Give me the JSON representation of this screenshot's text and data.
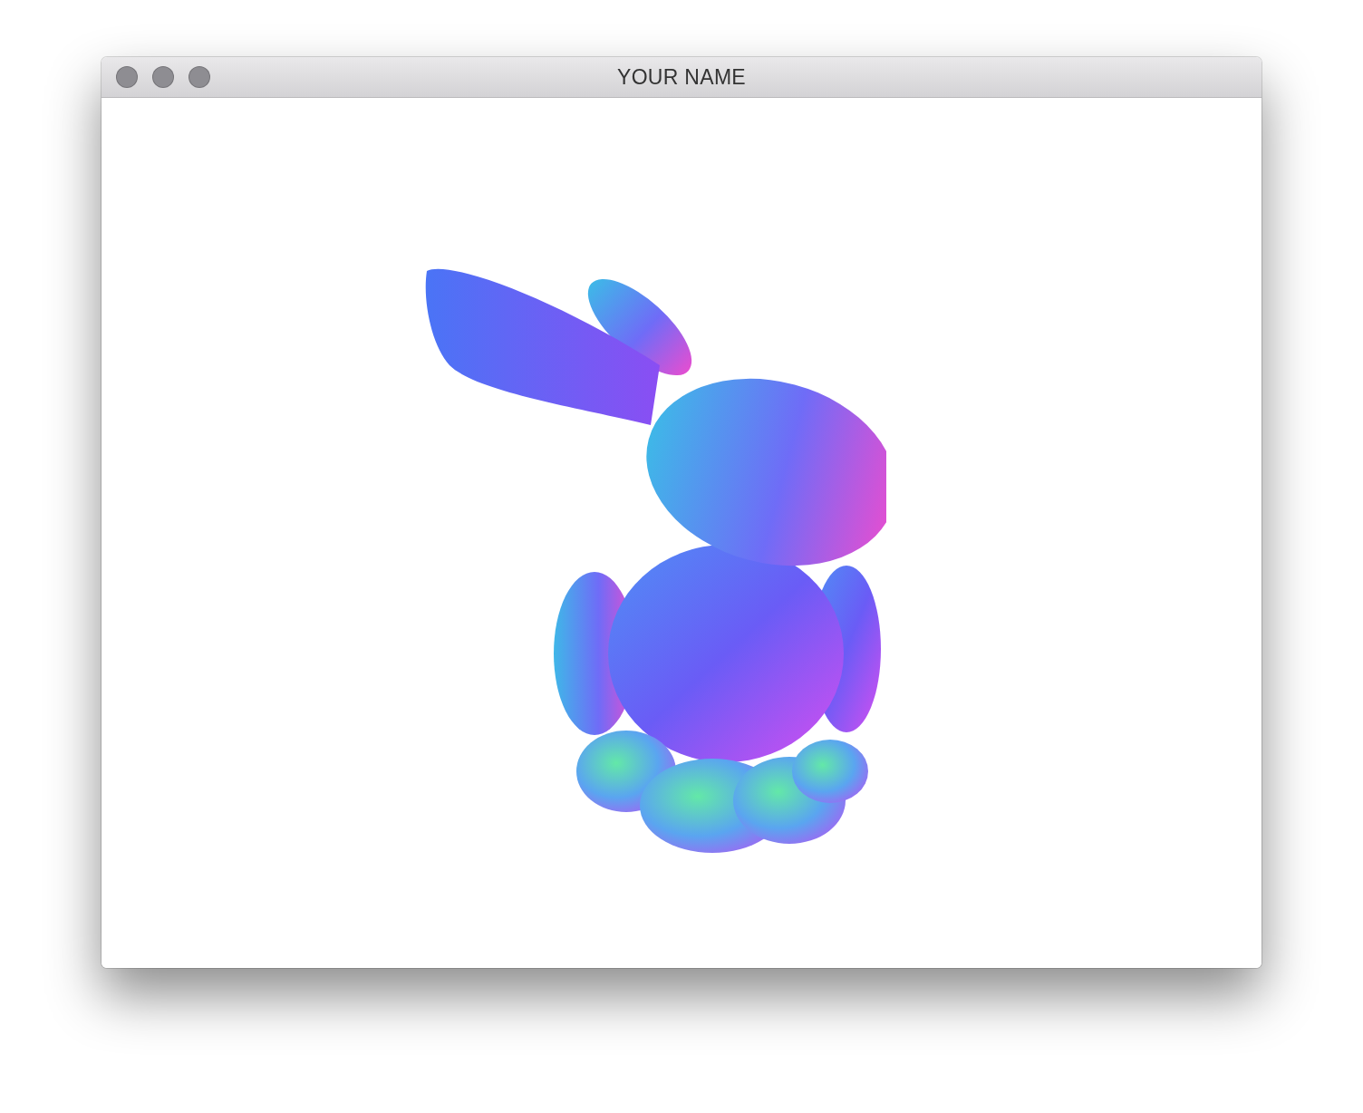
{
  "window": {
    "title": "YOUR NAME",
    "active": false
  }
}
